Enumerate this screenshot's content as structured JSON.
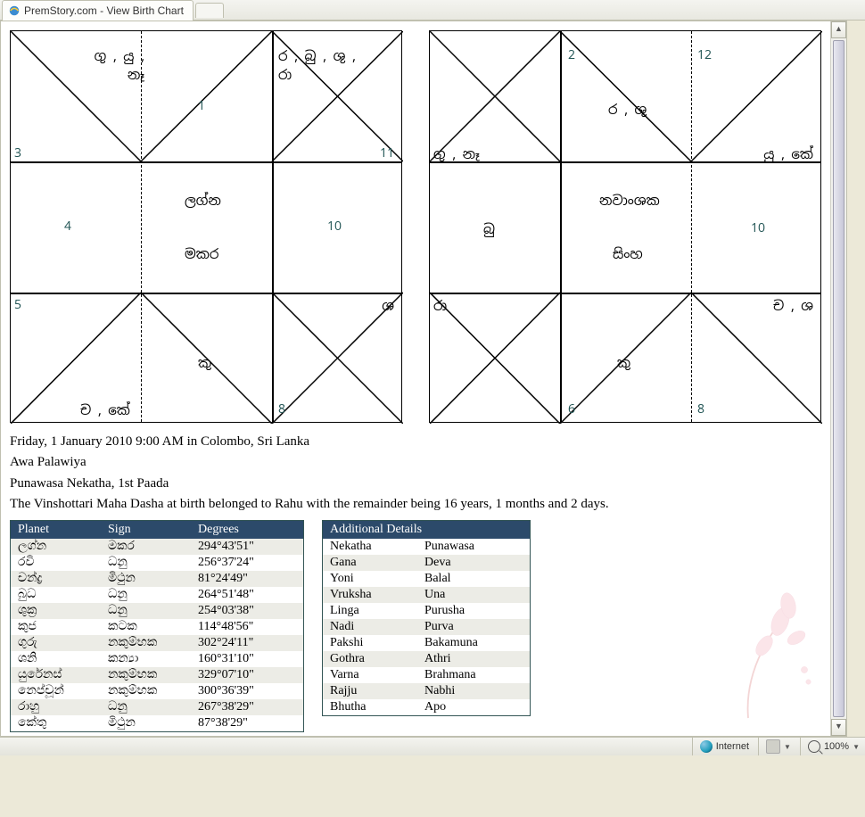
{
  "browser": {
    "tab_title": "PremStory.com - View Birth Chart",
    "zone": "Internet",
    "zoom": "100%"
  },
  "chart_left": {
    "topA": "ගු , යු ,\nනෑ",
    "center_top_num": "1",
    "topB": "ර , බු , ශු ,\nරා",
    "left_mid_top": "3",
    "right_mid_top": "11",
    "left_mid_num": "4",
    "center_word1": "ලග්න",
    "center_word2": "මකර",
    "right_mid_num": "10",
    "left_bot_top": "5",
    "right_bot_top": "ශ",
    "botA": "ච , කේ",
    "center_bot": "කු",
    "botB_num": "8"
  },
  "chart_right": {
    "top_left_num": "2",
    "top_right_num": "12",
    "center_top": "ර , ශු",
    "left_mid_planets": "ගු , නෑ",
    "right_mid_planets": "යු , කේ",
    "center_word1": "නවාංශක",
    "left_center": "බු",
    "center_word2": "සිංහ",
    "right_center_num": "10",
    "left_bot_top": "රා",
    "right_bot_top": "ච , ශ",
    "center_bot": "කු",
    "bot_left_num": "6",
    "bot_right_num": "8"
  },
  "info": {
    "line1": "Friday, 1 January 2010 9:00 AM in Colombo, Sri Lanka",
    "line2": "Awa Palawiya",
    "line3": "Punawasa Nekatha, 1st Paada",
    "line4": "The Vinshottari Maha Dasha at birth belonged to Rahu with the remainder being 16 years, 1 months and 2 days."
  },
  "planet_table": {
    "headers": [
      "Planet",
      "Sign",
      "Degrees"
    ],
    "rows": [
      {
        "p": "ලග්න",
        "s": "මකර",
        "d": "294°43'51\""
      },
      {
        "p": "රවි",
        "s": "ධනු",
        "d": "256°37'24\""
      },
      {
        "p": "චන්ද්‍ර",
        "s": "මිථුන",
        "d": "81°24'49\""
      },
      {
        "p": "බුධ",
        "s": "ධනු",
        "d": "264°51'48\""
      },
      {
        "p": "ශුක්‍ර",
        "s": "ධනු",
        "d": "254°03'38\""
      },
      {
        "p": "කුජ",
        "s": "කටක",
        "d": "114°48'56\""
      },
      {
        "p": "ගුරු",
        "s": "නකුම්භක",
        "d": "302°24'11\""
      },
      {
        "p": "ශනි",
        "s": "කන්‍යා",
        "d": "160°31'10\""
      },
      {
        "p": "යුරේනස්",
        "s": "නකුම්භක",
        "d": "329°07'10\""
      },
      {
        "p": "නෙප්චූන්",
        "s": "නකුම්භක",
        "d": "300°36'39\""
      },
      {
        "p": "රාහු",
        "s": "ධනු",
        "d": "267°38'29\""
      },
      {
        "p": "කේතු",
        "s": "මිථුන",
        "d": "87°38'29\""
      }
    ]
  },
  "additional": {
    "header": "Additional Details",
    "rows": [
      {
        "k": "Nekatha",
        "v": "Punawasa"
      },
      {
        "k": "Gana",
        "v": "Deva"
      },
      {
        "k": "Yoni",
        "v": "Balal"
      },
      {
        "k": "Vruksha",
        "v": "Una"
      },
      {
        "k": "Linga",
        "v": "Purusha"
      },
      {
        "k": "Nadi",
        "v": "Purva"
      },
      {
        "k": "Pakshi",
        "v": "Bakamuna"
      },
      {
        "k": "Gothra",
        "v": "Athri"
      },
      {
        "k": "Varna",
        "v": "Brahmana"
      },
      {
        "k": "Rajju",
        "v": "Nabhi"
      },
      {
        "k": "Bhutha",
        "v": "Apo"
      }
    ]
  }
}
